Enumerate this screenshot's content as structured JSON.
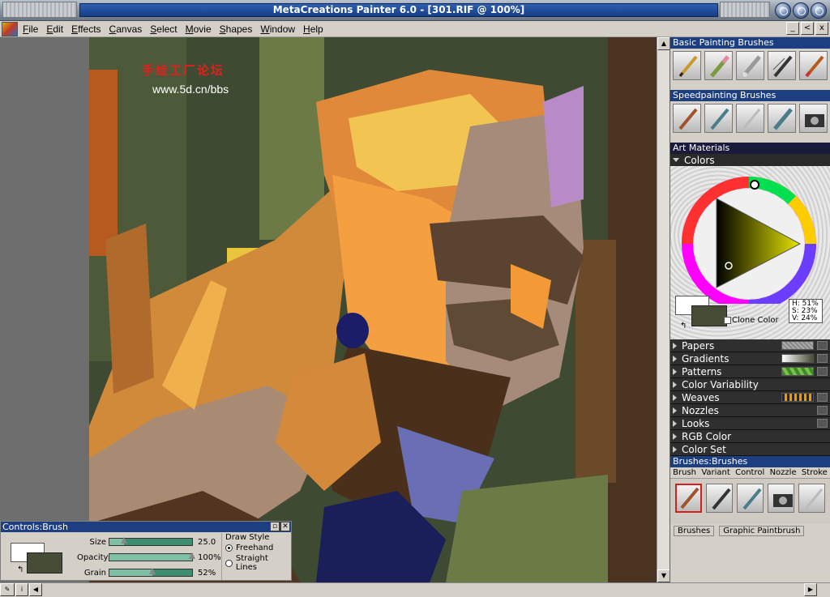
{
  "window": {
    "title": "MetaCreations Painter 6.0 - [301.RIF @ 100%]"
  },
  "menu": {
    "items": [
      "File",
      "Edit",
      "Effects",
      "Canvas",
      "Select",
      "Movie",
      "Shapes",
      "Window",
      "Help"
    ]
  },
  "mdi_buttons": [
    "_",
    "<",
    "x"
  ],
  "canvas": {
    "watermark_cn": "手绘工厂论坛",
    "watermark_url": "www.5d.cn/bbs"
  },
  "controls": {
    "title": "Controls:Brush",
    "sliders": [
      {
        "label": "Size",
        "value": "25.0",
        "level": 0.18
      },
      {
        "label": "Opacity",
        "value": "100%",
        "level": 1.0
      },
      {
        "label": "Grain",
        "value": "52%",
        "level": 0.52
      }
    ],
    "draw_style": {
      "label": "Draw Style",
      "options": [
        "Freehand",
        "Straight Lines"
      ],
      "selected": "Freehand"
    }
  },
  "panels": {
    "basic_brushes": {
      "title": "Basic Painting Brushes"
    },
    "speed_brushes": {
      "title": "Speedpainting Brushes"
    },
    "art_materials": {
      "title": "Art Materials",
      "colors_label": "Colors",
      "hsv": {
        "h": "H: 51%",
        "s": "S: 23%",
        "v": "V: 24%"
      },
      "clone_color": "Clone Color",
      "sections": [
        "Papers",
        "Gradients",
        "Patterns",
        "Color Variability",
        "Weaves",
        "Nozzles",
        "Looks",
        "RGB Color",
        "Color Set"
      ]
    },
    "brushes": {
      "title": "Brushes:Brushes",
      "tabs": [
        "Brush",
        "Variant",
        "Control",
        "Nozzle",
        "Stroke"
      ],
      "current_brush": "Brushes",
      "current_variant": "Graphic Paintbrush"
    }
  },
  "colors": {
    "primary": "#ffffff",
    "secondary": "#474c36",
    "title_bar": "#1d3f82"
  }
}
